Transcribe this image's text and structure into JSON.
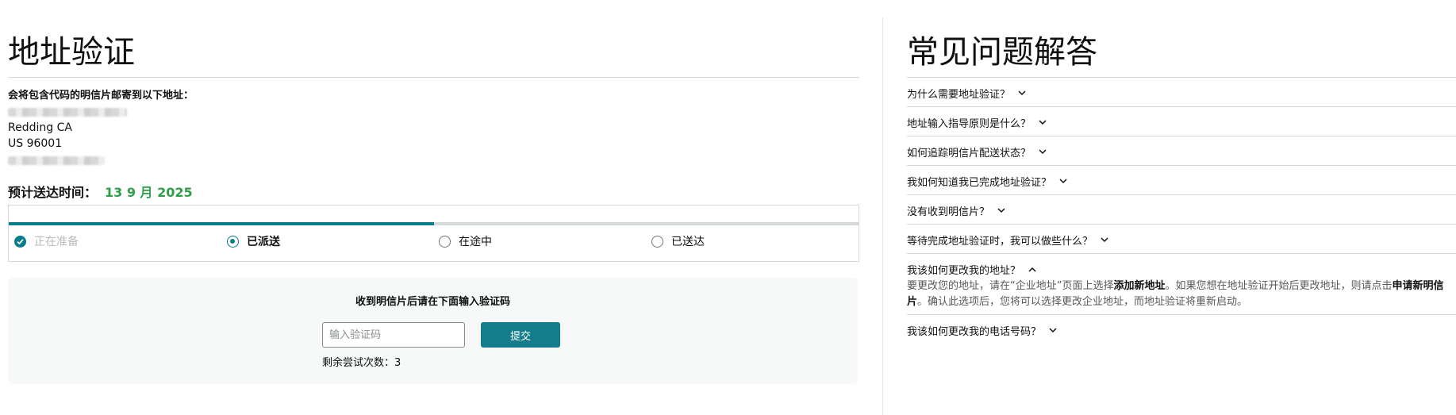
{
  "verify": {
    "title": "地址验证",
    "address_intro": "会将包含代码的明信片邮寄到以下地址：",
    "address_city": "Redding CA",
    "address_zip": "US 96001",
    "eta_label": "预计送达时间：",
    "eta_date": "13 9 月 2025",
    "progress_fraction": 0.5,
    "steps": [
      {
        "label": "正在准备",
        "state": "done"
      },
      {
        "label": "已派送",
        "state": "current"
      },
      {
        "label": "在途中",
        "state": "pending"
      },
      {
        "label": "已送达",
        "state": "pending"
      }
    ],
    "code_prompt": "收到明信片后请在下面输入验证码",
    "code_placeholder": "输入验证码",
    "submit_label": "提交",
    "attempts_label": "剩余尝试次数：3"
  },
  "faq": {
    "title": "常见问题解答",
    "items": [
      {
        "q": "为什么需要地址验证？",
        "expanded": false
      },
      {
        "q": "地址输入指导原则是什么？",
        "expanded": false
      },
      {
        "q": "如何追踪明信片配送状态？",
        "expanded": false
      },
      {
        "q": "我如何知道我已完成地址验证？",
        "expanded": false
      },
      {
        "q": "没有收到明信片？",
        "expanded": false
      },
      {
        "q": "等待完成地址验证时，我可以做些什么？",
        "expanded": false
      },
      {
        "q": "我该如何更改我的地址？",
        "expanded": true
      },
      {
        "q": "我该如何更改我的电话号码？",
        "expanded": false
      }
    ],
    "answer": {
      "p1": "要更改您的地址，请在“企业地址”页面上选择",
      "b1": "添加新地址",
      "p2": "。如果您想在地址验证开始后更改地址，则请点击",
      "b2": "申请新明信片",
      "p3": "。确认此选项后，您将可以选择更改企业地址，而地址验证将重新启动。"
    }
  }
}
